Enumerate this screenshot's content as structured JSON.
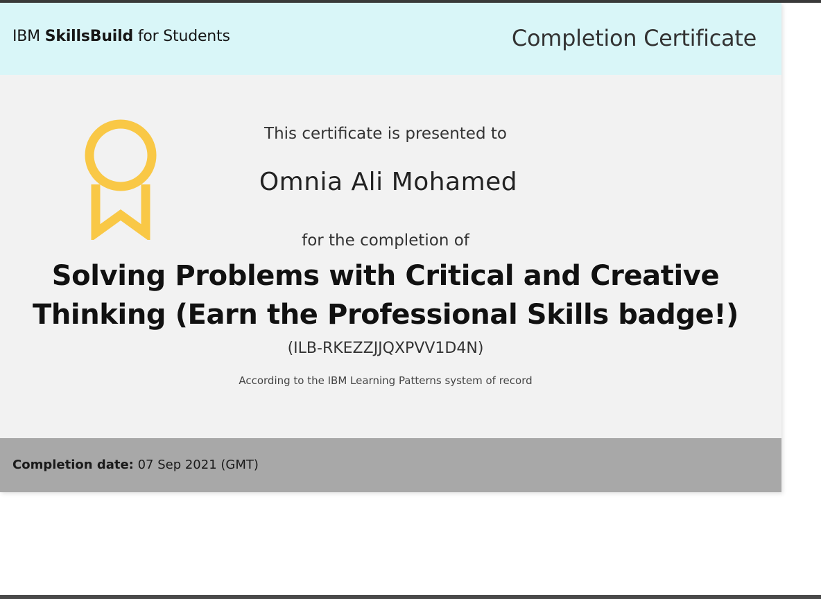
{
  "header": {
    "brand_prefix": "IBM ",
    "brand_bold": "SkillsBuild",
    "brand_suffix": " for Students",
    "title": "Completion Certificate"
  },
  "certificate": {
    "presented_to_label": "This certificate is presented to",
    "recipient_name": "Omnia Ali Mohamed",
    "completion_of_label": "for the completion of",
    "course_title": "Solving Problems with Critical and Creative Thinking (Earn the Professional Skills badge!)",
    "course_code": "(ILB-RKEZZJJQXPVV1D4N)",
    "record_note": "According to the IBM Learning Patterns system of record"
  },
  "footer": {
    "completion_date_label": "Completion date:",
    "completion_date_value": " 07 Sep 2021 (GMT)"
  },
  "colors": {
    "header_bg": "#d9f6f8",
    "body_bg": "#f2f2f2",
    "footer_bg": "#a8a8a8",
    "badge": "#f9c846"
  },
  "icons": {
    "badge": "award-ribbon-icon"
  }
}
